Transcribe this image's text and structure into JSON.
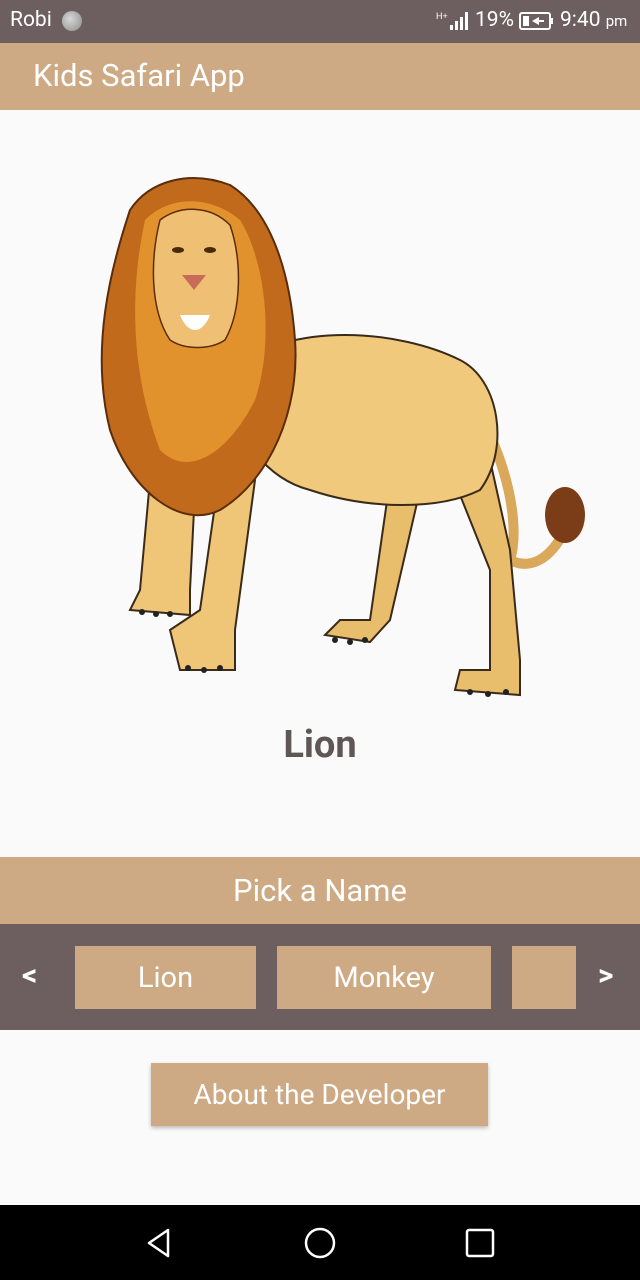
{
  "status_bar": {
    "carrier": "Robi",
    "battery_percent": "19%",
    "time": "9:40",
    "time_suffix": "pm",
    "network_label": "H+"
  },
  "app_bar": {
    "title": "Kids Safari App"
  },
  "main": {
    "image_icon": "lion-illustration",
    "animal_name": "Lion"
  },
  "picker": {
    "header": "Pick a Name",
    "prev_label": "<",
    "next_label": ">",
    "options": [
      "Lion",
      "Monkey",
      ""
    ]
  },
  "about_button": {
    "label": "About the Developer"
  },
  "nav": {
    "icons": [
      "back-icon",
      "home-icon",
      "recents-icon"
    ]
  },
  "colors": {
    "primary": "#cdaa84",
    "dark": "#6d5f5f",
    "text_dark": "#5f5656",
    "background": "#fafafa"
  }
}
